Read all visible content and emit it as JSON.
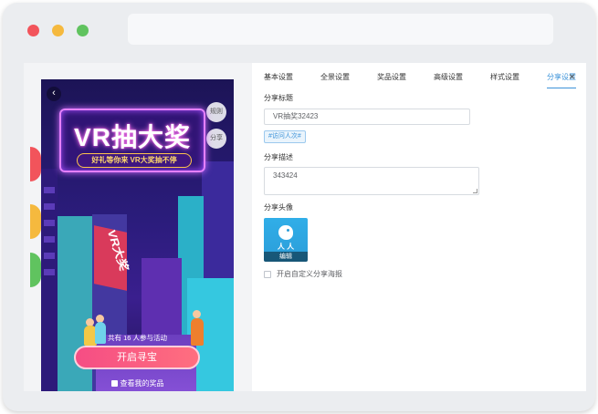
{
  "phone": {
    "back_glyph": "‹",
    "side_buttons": [
      "规则",
      "分享"
    ],
    "sign_title": "VR抽大奖",
    "sign_subtitle": "好礼等你来 VR大奖抽不停",
    "shop_sign": "VR大奖",
    "participants": "共有 16 人参与活动",
    "start_button": "开启寻宝",
    "my_prize": "查看我的奖品"
  },
  "panel": {
    "tabs": [
      {
        "label": "基本设置",
        "active": false
      },
      {
        "label": "全景设置",
        "active": false
      },
      {
        "label": "奖品设置",
        "active": false
      },
      {
        "label": "高级设置",
        "active": false
      },
      {
        "label": "样式设置",
        "active": false
      },
      {
        "label": "分享设置",
        "active": true
      }
    ],
    "close_glyph": "×",
    "share_title_label": "分享标题",
    "share_title_value": "VR抽奖32423",
    "insert_tag": "#访问人次#",
    "share_desc_label": "分享描述",
    "share_desc_value": "343424",
    "share_avatar_label": "分享头像",
    "avatar_edit": "编辑",
    "custom_poster_label": "开启自定义分享海报",
    "custom_poster_checked": false
  },
  "colors": {
    "accent": "#3c93d9",
    "start_button": "#f54d84",
    "traffic_red": "#f2545b",
    "traffic_yellow": "#f5b93e",
    "traffic_green": "#60c35f"
  }
}
